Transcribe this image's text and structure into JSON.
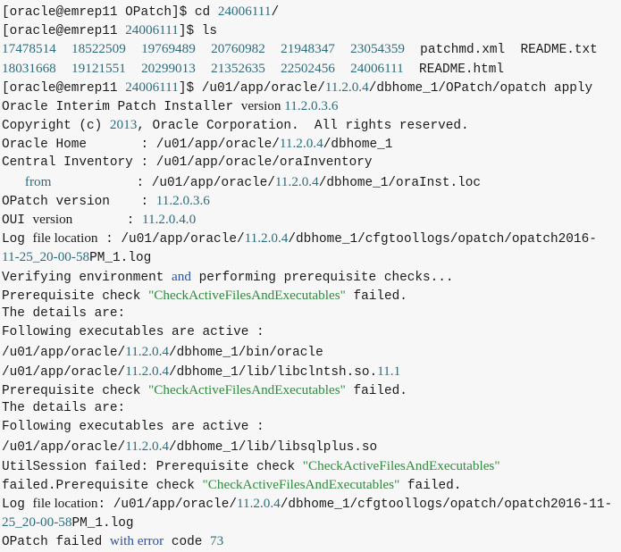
{
  "terminal": {
    "title": "OPatch apply terminal session",
    "background_color": "#f7f7f7",
    "colors": {
      "default_text": "#1a1a1a",
      "number": "#2d6c7d",
      "keyword": "#2b50a8",
      "string": "#2e8b3d"
    },
    "prompt_user_host": "[oracle@emrep11",
    "lines": [
      {
        "id": "l01",
        "tokens": [
          {
            "text": "[oracle@emrep11 OPatch]$ cd ",
            "font": "mono",
            "color": "default"
          },
          {
            "text": "24006111",
            "font": "serif",
            "color": "num"
          },
          {
            "text": "/",
            "font": "mono",
            "color": "default"
          }
        ]
      },
      {
        "id": "l02",
        "tokens": [
          {
            "text": "[oracle@emrep11 ",
            "font": "mono",
            "color": "default"
          },
          {
            "text": "24006111",
            "font": "serif",
            "color": "num"
          },
          {
            "text": "]$ ls",
            "font": "mono",
            "color": "default"
          }
        ]
      },
      {
        "id": "l03",
        "tokens": [
          {
            "text": "17478514",
            "font": "serif",
            "color": "num"
          },
          {
            "text": "  ",
            "font": "mono",
            "color": "default"
          },
          {
            "text": "18522509",
            "font": "serif",
            "color": "num"
          },
          {
            "text": "  ",
            "font": "mono",
            "color": "default"
          },
          {
            "text": "19769489",
            "font": "serif",
            "color": "num"
          },
          {
            "text": "  ",
            "font": "mono",
            "color": "default"
          },
          {
            "text": "20760982",
            "font": "serif",
            "color": "num"
          },
          {
            "text": "  ",
            "font": "mono",
            "color": "default"
          },
          {
            "text": "21948347",
            "font": "serif",
            "color": "num"
          },
          {
            "text": "  ",
            "font": "mono",
            "color": "default"
          },
          {
            "text": "23054359",
            "font": "serif",
            "color": "num"
          },
          {
            "text": "  patchmd.xml  README.txt",
            "font": "mono",
            "color": "default"
          }
        ]
      },
      {
        "id": "l04",
        "tokens": [
          {
            "text": "18031668",
            "font": "serif",
            "color": "num"
          },
          {
            "text": "  ",
            "font": "mono",
            "color": "default"
          },
          {
            "text": "19121551",
            "font": "serif",
            "color": "num"
          },
          {
            "text": "  ",
            "font": "mono",
            "color": "default"
          },
          {
            "text": "20299013",
            "font": "serif",
            "color": "num"
          },
          {
            "text": "  ",
            "font": "mono",
            "color": "default"
          },
          {
            "text": "21352635",
            "font": "serif",
            "color": "num"
          },
          {
            "text": "  ",
            "font": "mono",
            "color": "default"
          },
          {
            "text": "22502456",
            "font": "serif",
            "color": "num"
          },
          {
            "text": "  ",
            "font": "mono",
            "color": "default"
          },
          {
            "text": "24006111",
            "font": "serif",
            "color": "num"
          },
          {
            "text": "  README.html",
            "font": "mono",
            "color": "default"
          }
        ]
      },
      {
        "id": "l05",
        "tokens": [
          {
            "text": "[oracle@emrep11 ",
            "font": "mono",
            "color": "default"
          },
          {
            "text": "24006111",
            "font": "serif",
            "color": "num"
          },
          {
            "text": "]$ /u01/app/oracle/",
            "font": "mono",
            "color": "default"
          },
          {
            "text": "11.2.0.4",
            "font": "serif",
            "color": "num"
          },
          {
            "text": "/dbhome_1/OPatch/opatch apply",
            "font": "mono",
            "color": "default"
          }
        ]
      },
      {
        "id": "l06",
        "tokens": [
          {
            "text": "Oracle Interim Patch Installer ",
            "font": "mono",
            "color": "default"
          },
          {
            "text": "version ",
            "font": "serif",
            "color": "default"
          },
          {
            "text": "11.2.0.3.6",
            "font": "serif",
            "color": "num"
          }
        ]
      },
      {
        "id": "l07",
        "tokens": [
          {
            "text": "Copyright (c) ",
            "font": "mono",
            "color": "default"
          },
          {
            "text": "2013",
            "font": "serif",
            "color": "num"
          },
          {
            "text": ", Oracle Corporation.  All rights reserved.",
            "font": "mono",
            "color": "default"
          }
        ]
      },
      {
        "id": "l08",
        "tokens": [
          {
            "text": "Oracle Home       : /u01/app/oracle/",
            "font": "mono",
            "color": "default"
          },
          {
            "text": "11.2.0.4",
            "font": "serif",
            "color": "num"
          },
          {
            "text": "/dbhome_1",
            "font": "mono",
            "color": "default"
          }
        ]
      },
      {
        "id": "l09",
        "tokens": [
          {
            "text": "Central Inventory : /u01/app/oracle/oraInventory",
            "font": "mono",
            "color": "default"
          }
        ]
      },
      {
        "id": "l10",
        "tokens": [
          {
            "text": "   ",
            "font": "mono",
            "color": "default"
          },
          {
            "text": "from",
            "font": "serif",
            "color": "num"
          },
          {
            "text": "           : /u01/app/oracle/",
            "font": "mono",
            "color": "default"
          },
          {
            "text": "11.2.0.4",
            "font": "serif",
            "color": "num"
          },
          {
            "text": "/dbhome_1/oraInst.loc",
            "font": "mono",
            "color": "default"
          }
        ]
      },
      {
        "id": "l11",
        "tokens": [
          {
            "text": "OPatch version    : ",
            "font": "mono",
            "color": "default"
          },
          {
            "text": "11.2.0.3.6",
            "font": "serif",
            "color": "num"
          }
        ]
      },
      {
        "id": "l12",
        "tokens": [
          {
            "text": "OUI ",
            "font": "mono",
            "color": "default"
          },
          {
            "text": "version",
            "font": "serif",
            "color": "default"
          },
          {
            "text": "       : ",
            "font": "mono",
            "color": "default"
          },
          {
            "text": "11.2.0.4.0",
            "font": "serif",
            "color": "num"
          }
        ]
      },
      {
        "id": "l13",
        "tokens": [
          {
            "text": "Log ",
            "font": "mono",
            "color": "default"
          },
          {
            "text": "file location",
            "font": "serif",
            "color": "default"
          },
          {
            "text": " : /u01/app/oracle/",
            "font": "mono",
            "color": "default"
          },
          {
            "text": "11.2.0.4",
            "font": "serif",
            "color": "num"
          },
          {
            "text": "/dbhome_1/cfgtoollogs/opatch/opatch2016-",
            "font": "mono",
            "color": "default"
          }
        ]
      },
      {
        "id": "l14",
        "tokens": [
          {
            "text": "11-25_20-00-58",
            "font": "serif",
            "color": "num"
          },
          {
            "text": "PM_1.log",
            "font": "mono",
            "color": "default"
          }
        ]
      },
      {
        "id": "l15",
        "tokens": [
          {
            "text": "Verifying environment ",
            "font": "mono",
            "color": "default"
          },
          {
            "text": "and",
            "font": "serif",
            "color": "blue"
          },
          {
            "text": " performing prerequisite checks...",
            "font": "mono",
            "color": "default"
          }
        ]
      },
      {
        "id": "l16",
        "tokens": [
          {
            "text": "Prerequisite check ",
            "font": "mono",
            "color": "default"
          },
          {
            "text": "\"CheckActiveFilesAndExecutables\"",
            "font": "serif",
            "color": "green"
          },
          {
            "text": " failed.",
            "font": "mono",
            "color": "default"
          }
        ]
      },
      {
        "id": "l17",
        "tokens": [
          {
            "text": "The details are:",
            "font": "mono",
            "color": "default"
          }
        ]
      },
      {
        "id": "l18",
        "tokens": [
          {
            "text": "Following executables are active :",
            "font": "mono",
            "color": "default"
          }
        ]
      },
      {
        "id": "l19",
        "tokens": [
          {
            "text": "/u01/app/oracle/",
            "font": "mono",
            "color": "default"
          },
          {
            "text": "11.2.0.4",
            "font": "serif",
            "color": "num"
          },
          {
            "text": "/dbhome_1/bin/oracle",
            "font": "mono",
            "color": "default"
          }
        ]
      },
      {
        "id": "l20",
        "tokens": [
          {
            "text": "/u01/app/oracle/",
            "font": "mono",
            "color": "default"
          },
          {
            "text": "11.2.0.4",
            "font": "serif",
            "color": "num"
          },
          {
            "text": "/dbhome_1/lib/libclntsh.so.",
            "font": "mono",
            "color": "default"
          },
          {
            "text": "11.1",
            "font": "serif",
            "color": "num"
          }
        ]
      },
      {
        "id": "l21",
        "tokens": [
          {
            "text": "Prerequisite check ",
            "font": "mono",
            "color": "default"
          },
          {
            "text": "\"CheckActiveFilesAndExecutables\"",
            "font": "serif",
            "color": "green"
          },
          {
            "text": " failed.",
            "font": "mono",
            "color": "default"
          }
        ]
      },
      {
        "id": "l22",
        "tokens": [
          {
            "text": "The details are:",
            "font": "mono",
            "color": "default"
          }
        ]
      },
      {
        "id": "l23",
        "tokens": [
          {
            "text": "Following executables are active :",
            "font": "mono",
            "color": "default"
          }
        ]
      },
      {
        "id": "l24",
        "tokens": [
          {
            "text": "/u01/app/oracle/",
            "font": "mono",
            "color": "default"
          },
          {
            "text": "11.2.0.4",
            "font": "serif",
            "color": "num"
          },
          {
            "text": "/dbhome_1/lib/libsqlplus.so",
            "font": "mono",
            "color": "default"
          }
        ]
      },
      {
        "id": "l25",
        "tokens": [
          {
            "text": "UtilSession failed: Prerequisite check ",
            "font": "mono",
            "color": "default"
          },
          {
            "text": "\"CheckActiveFilesAndExecutables\"",
            "font": "serif",
            "color": "green"
          }
        ]
      },
      {
        "id": "l26",
        "tokens": [
          {
            "text": "failed.Prerequisite check ",
            "font": "mono",
            "color": "default"
          },
          {
            "text": "\"CheckActiveFilesAndExecutables\"",
            "font": "serif",
            "color": "green"
          },
          {
            "text": " failed.",
            "font": "mono",
            "color": "default"
          }
        ]
      },
      {
        "id": "l27",
        "tokens": [
          {
            "text": "Log ",
            "font": "mono",
            "color": "default"
          },
          {
            "text": "file location",
            "font": "serif",
            "color": "default"
          },
          {
            "text": ": /u01/app/oracle/",
            "font": "mono",
            "color": "default"
          },
          {
            "text": "11.2.0.4",
            "font": "serif",
            "color": "num"
          },
          {
            "text": "/dbhome_1/cfgtoollogs/opatch/opatch2016-11-",
            "font": "mono",
            "color": "default"
          }
        ]
      },
      {
        "id": "l28",
        "tokens": [
          {
            "text": "25_20-00-58",
            "font": "serif",
            "color": "num"
          },
          {
            "text": "PM_1.log",
            "font": "mono",
            "color": "default"
          }
        ]
      },
      {
        "id": "l29",
        "tokens": [
          {
            "text": "OPatch failed ",
            "font": "mono",
            "color": "default"
          },
          {
            "text": "with error",
            "font": "serif",
            "color": "blue"
          },
          {
            "text": " code ",
            "font": "mono",
            "color": "default"
          },
          {
            "text": "73",
            "font": "serif",
            "color": "num"
          }
        ]
      }
    ]
  }
}
